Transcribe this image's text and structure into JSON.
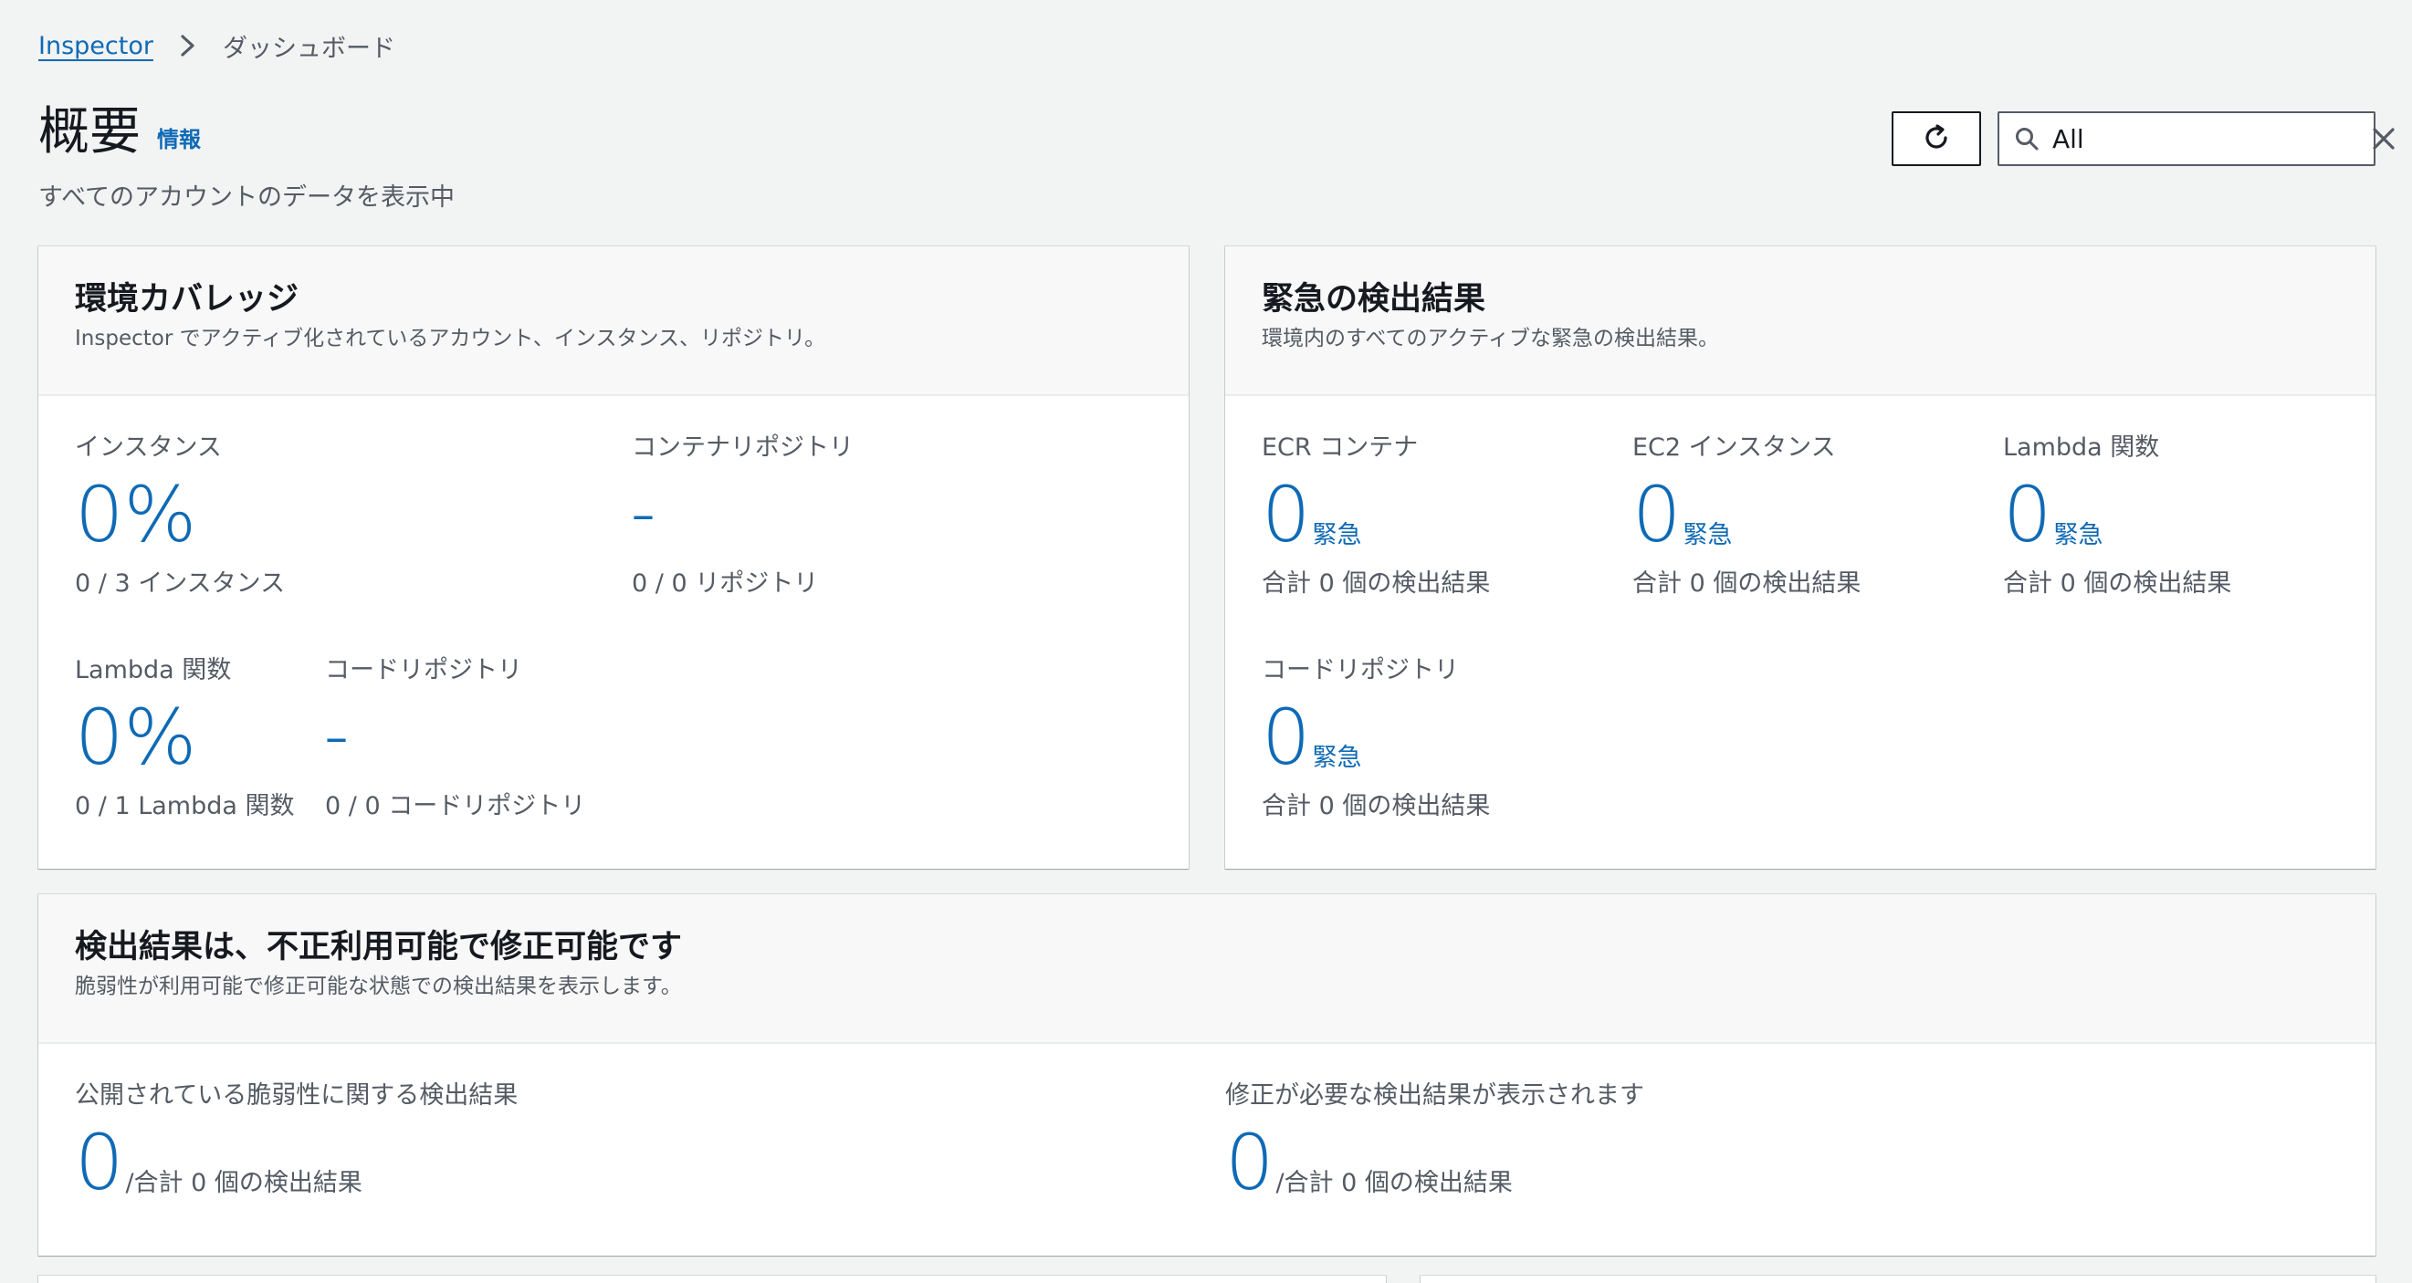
{
  "breadcrumb": {
    "root": "Inspector",
    "current": "ダッシュボード"
  },
  "header": {
    "title": "概要",
    "info": "情報",
    "subtitle": "すべてのアカウントのデータを表示中"
  },
  "search": {
    "value": "All"
  },
  "coverage": {
    "title": "環境カバレッジ",
    "description": "Inspector でアクティブ化されているアカウント、インスタンス、リポジトリ。",
    "instances": {
      "label": "インスタンス",
      "value": "0%",
      "sub": "0 / 3 インスタンス"
    },
    "container_repos": {
      "label": "コンテナリポジトリ",
      "value": "–",
      "sub": "0 / 0 リポジトリ"
    },
    "lambda": {
      "label": "Lambda 関数",
      "value": "0%",
      "sub": "0 / 1 Lambda 関数"
    },
    "code_repos": {
      "label": "コードリポジトリ",
      "value": "–",
      "sub": "0 / 0 コードリポジトリ"
    }
  },
  "critical": {
    "title": "緊急の検出結果",
    "description": "環境内のすべてのアクティブな緊急の検出結果。",
    "unit": "緊急",
    "ecr": {
      "label": "ECR コンテナ",
      "value": "0",
      "sub": "合計 0 個の検出結果"
    },
    "ec2": {
      "label": "EC2 インスタンス",
      "value": "0",
      "sub": "合計 0 個の検出結果"
    },
    "lambda": {
      "label": "Lambda 関数",
      "value": "0",
      "sub": "合計 0 個の検出結果"
    },
    "code": {
      "label": "コードリポジトリ",
      "value": "0",
      "sub": "合計 0 個の検出結果"
    }
  },
  "exploitable": {
    "title": "検出結果は、不正利用可能で修正可能です",
    "description": "脆弱性が利用可能で修正可能な状態での検出結果を表示します。",
    "public": {
      "label": "公開されている脆弱性に関する検出結果",
      "value": "0",
      "total": "/合計 0 個の検出結果"
    },
    "fix": {
      "label": "修正が必要な検出結果が表示されます",
      "value": "0",
      "total": "/合計 0 個の検出結果"
    }
  },
  "colors": {
    "accent": "#0f6ab5",
    "background": "#f2f3f3",
    "text": "#16191f",
    "muted": "#545b64"
  }
}
